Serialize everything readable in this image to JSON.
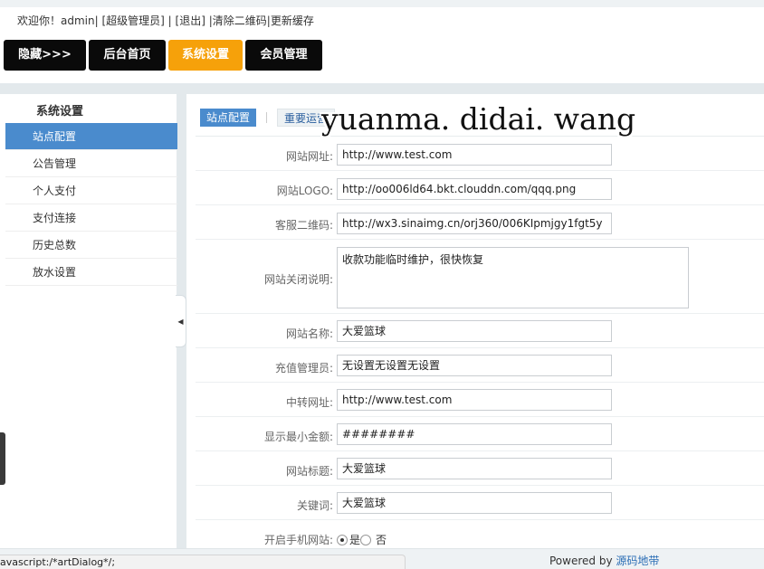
{
  "header": {
    "welcome": "欢迎你！admin",
    "role": "[超级管理员]",
    "logout": "[退出]",
    "clear_qr": "清除二维码",
    "refresh_cache": "更新缓存"
  },
  "nav": {
    "items": [
      "隐藏>>>",
      "后台首页",
      "系统设置",
      "会员管理"
    ],
    "active": "系统设置"
  },
  "sidebar": {
    "title": "系统设置",
    "items": [
      "站点配置",
      "公告管理",
      "个人支付",
      "支付连接",
      "历史总数",
      "放水设置"
    ],
    "active": "站点配置"
  },
  "tabs": {
    "items": [
      "站点配置",
      "重要运营"
    ],
    "active": "站点配置"
  },
  "watermark": "yuanma. didai. wang",
  "form": {
    "site_url": {
      "label": "网站网址:",
      "value": "http://www.test.com"
    },
    "site_logo": {
      "label": "网站LOGO:",
      "value": "http://oo006ld64.bkt.clouddn.com/qqq.png"
    },
    "service_qr": {
      "label": "客服二维码:",
      "value": "http://wx3.sinaimg.cn/orj360/006KIpmjgy1fgt5y"
    },
    "close_note": {
      "label": "网站关闭说明:",
      "value": "收款功能临时维护，很快恢复"
    },
    "site_name": {
      "label": "网站名称:",
      "value": "大爱篮球"
    },
    "recharge_admin": {
      "label": "充值管理员:",
      "value": "无设置无设置无设置"
    },
    "relay_url": {
      "label": "中转网址:",
      "value": "http://www.test.com"
    },
    "min_amount": {
      "label": "显示最小金额:",
      "value": "########"
    },
    "site_title": {
      "label": "网站标题:",
      "value": "大爱篮球"
    },
    "keywords": {
      "label": "关键词:",
      "value": "大爱篮球"
    },
    "mobile_site": {
      "label": "开启手机网站:",
      "yes": "是",
      "no": "否",
      "selected": "是"
    }
  },
  "footer": {
    "powered_by": "Powered by",
    "brand": "源码地带"
  },
  "statusbar": {
    "text": "avascript:/*artDialog*/;"
  },
  "icons": {
    "toggle": "caret-left-icon"
  },
  "colors": {
    "accent_blue": "#4a8bcd",
    "active_orange": "#f6a10a",
    "nav_dark": "#0a0a0a"
  }
}
